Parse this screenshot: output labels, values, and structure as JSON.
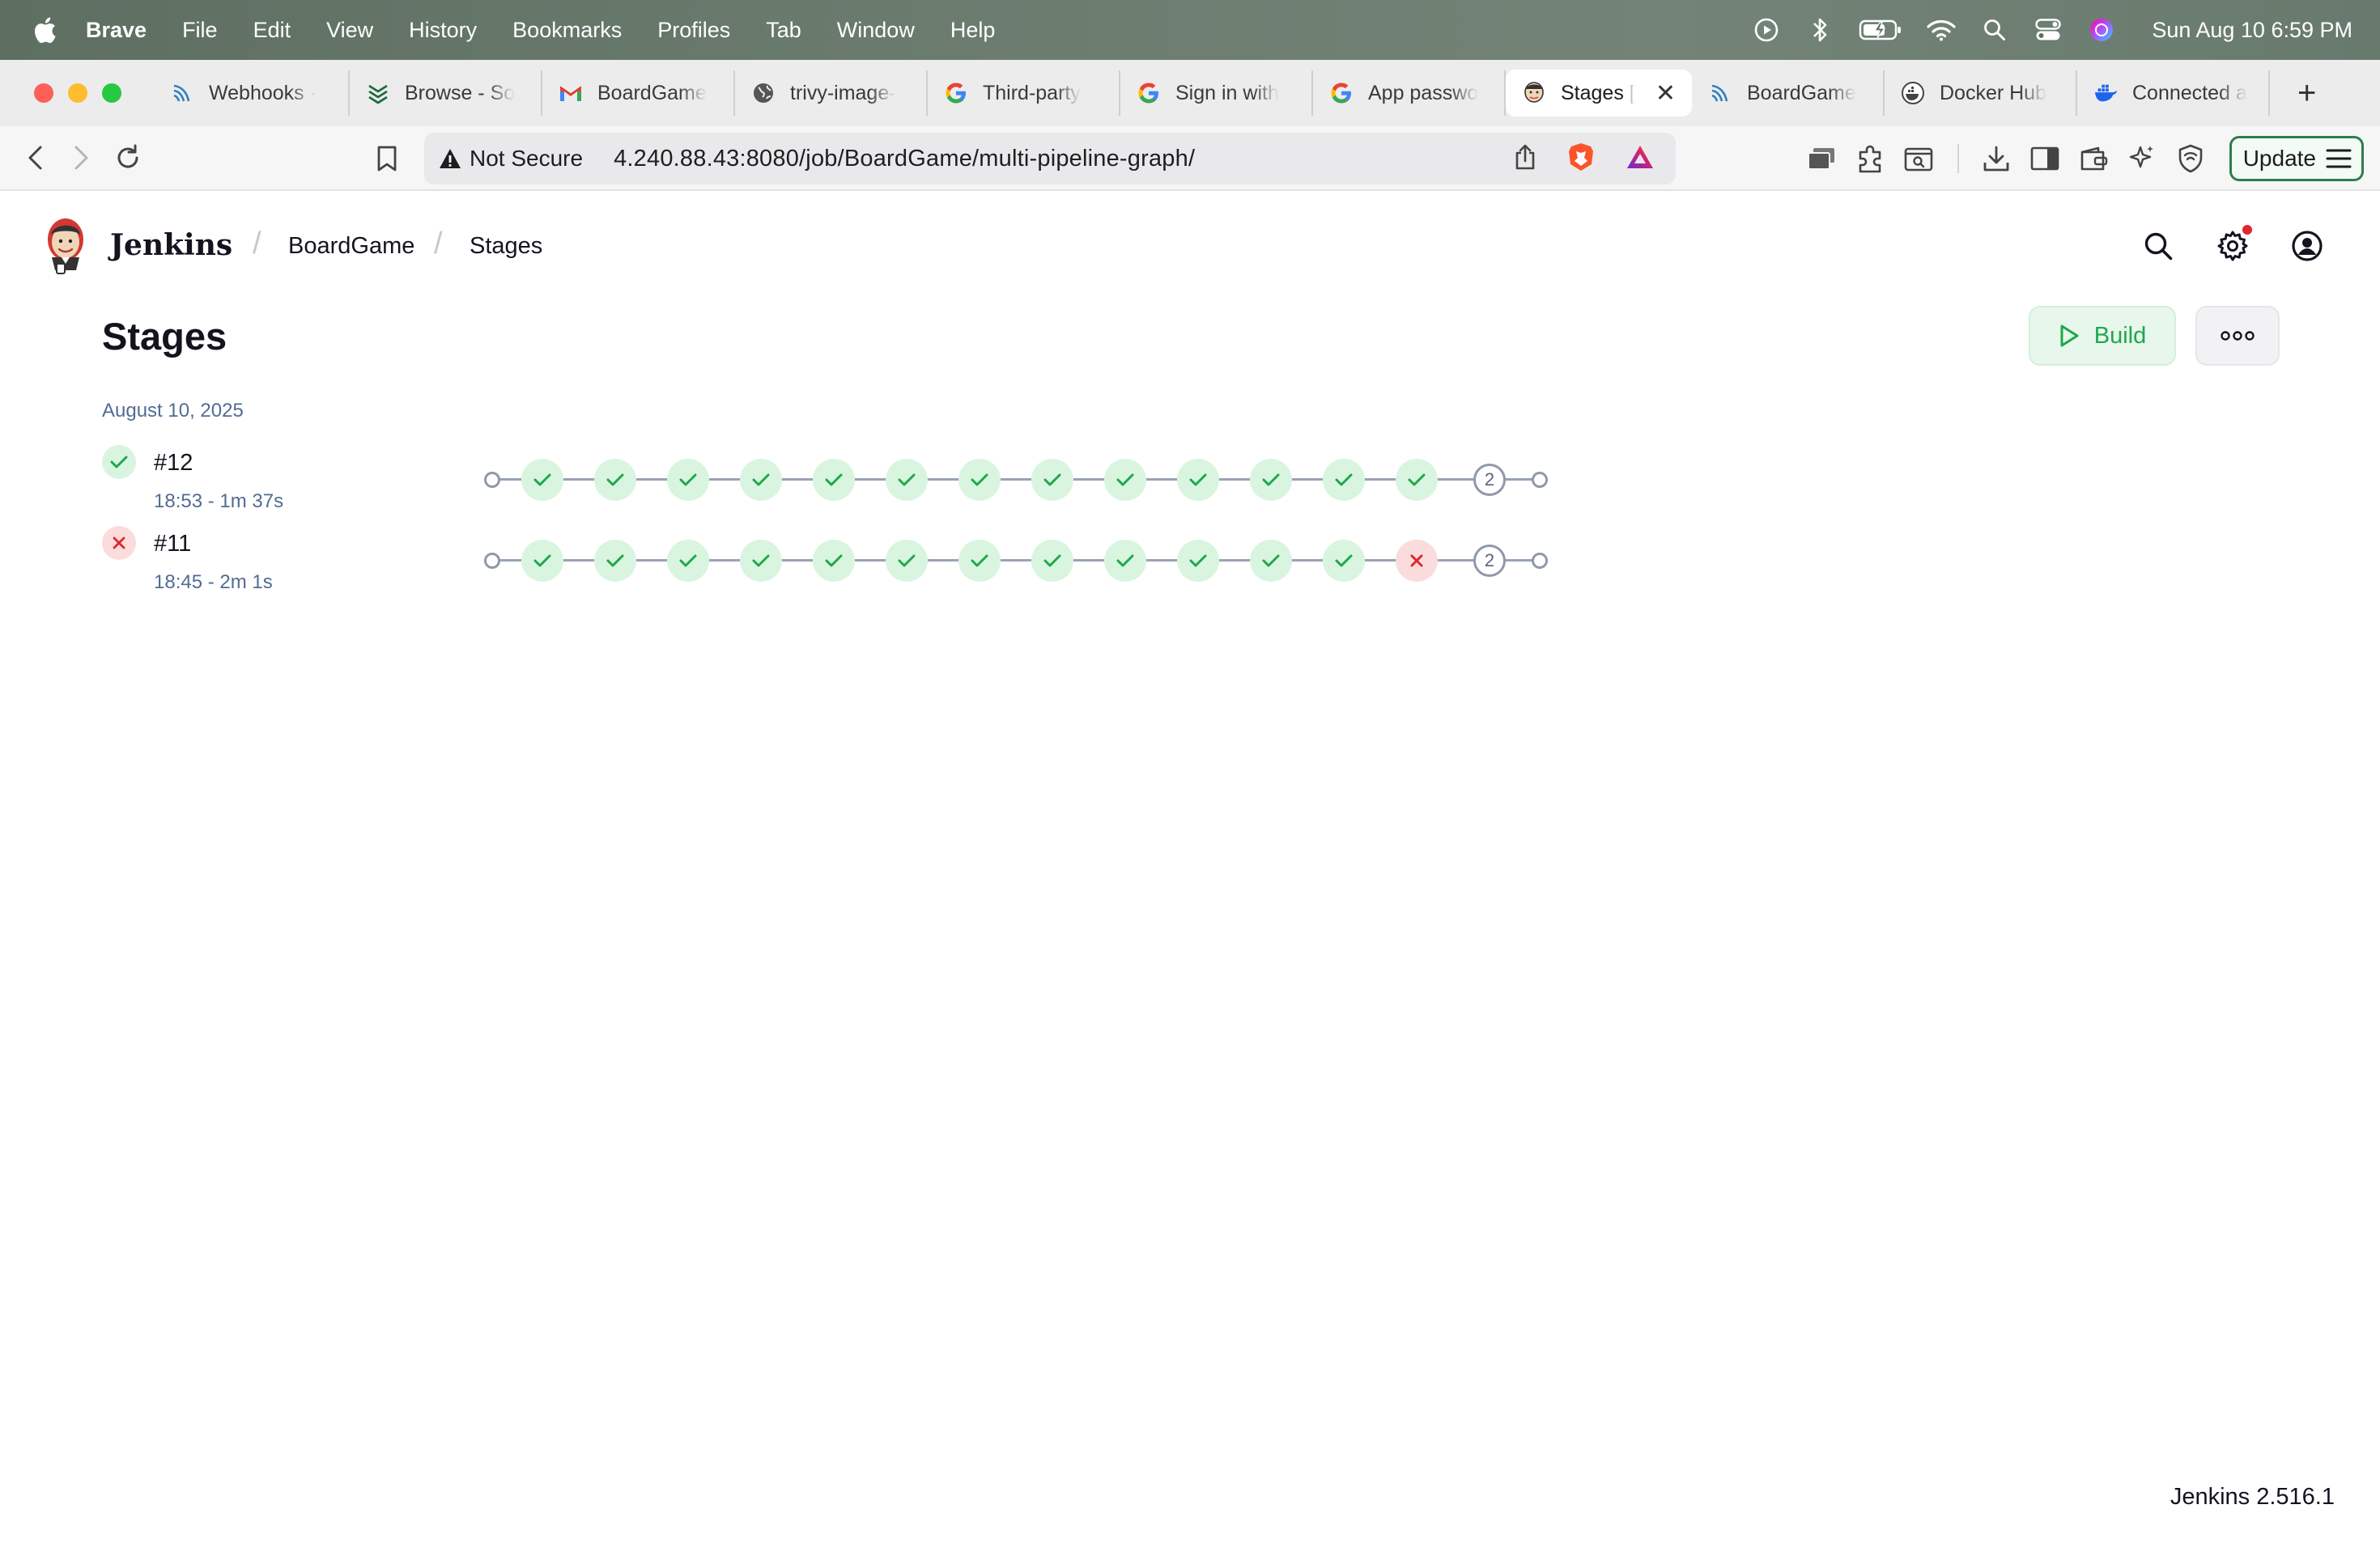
{
  "menubar": {
    "app": "Brave",
    "items": [
      "File",
      "Edit",
      "View",
      "History",
      "Bookmarks",
      "Profiles",
      "Tab",
      "Window",
      "Help"
    ],
    "clock": "Sun Aug 10  6:59 PM",
    "icons": [
      "play-circle-icon",
      "bluetooth-icon",
      "battery-icon",
      "wifi-icon",
      "spotlight-search-icon",
      "control-center-icon",
      "siri-icon"
    ]
  },
  "tabs": [
    {
      "label": "Webhooks · ",
      "icon": "webhooks-icon",
      "active": false
    },
    {
      "label": "Browse - So",
      "icon": "sonarqube-icon",
      "active": false
    },
    {
      "label": "BoardGame",
      "icon": "gmail-icon",
      "active": false
    },
    {
      "label": "trivy-image-",
      "icon": "globe-icon",
      "active": false
    },
    {
      "label": "Third-party ",
      "icon": "google-icon",
      "active": false
    },
    {
      "label": "Sign in with",
      "icon": "google-icon",
      "active": false
    },
    {
      "label": "App passwo",
      "icon": "google-icon",
      "active": false
    },
    {
      "label": "Stages [",
      "icon": "jenkins-icon",
      "active": true
    },
    {
      "label": "BoardGame",
      "icon": "webhooks-icon",
      "active": false
    },
    {
      "label": "Docker Hub",
      "icon": "docker-icon",
      "active": false
    },
    {
      "label": "Connected a",
      "icon": "docker-icon",
      "active": false
    }
  ],
  "toolbar": {
    "security_label": "Not Secure",
    "url": "4.240.88.43:8080/job/BoardGame/multi-pipeline-graph/",
    "update_label": "Update"
  },
  "jenkins": {
    "brand": "Jenkins",
    "breadcrumbs": [
      "BoardGame",
      "Stages"
    ],
    "page_title": "Stages",
    "build_label": "Build",
    "date_group": "August 10, 2025",
    "runs": [
      {
        "id": "#12",
        "status": "success",
        "meta": "18:53 - 1m 37s",
        "stages": [
          "success",
          "success",
          "success",
          "success",
          "success",
          "success",
          "success",
          "success",
          "success",
          "success",
          "success",
          "success",
          "success"
        ],
        "collapsed_count": "2"
      },
      {
        "id": "#11",
        "status": "failure",
        "meta": "18:45 - 2m 1s",
        "stages": [
          "success",
          "success",
          "success",
          "success",
          "success",
          "success",
          "success",
          "success",
          "success",
          "success",
          "success",
          "success",
          "failure"
        ],
        "collapsed_count": "2"
      }
    ],
    "version": "Jenkins 2.516.1"
  },
  "colors": {
    "success": "#1ea84b",
    "success_bg": "#d9f5e0",
    "failure": "#e0262f",
    "failure_bg": "#fbdcdc",
    "link_muted": "#526c92"
  }
}
